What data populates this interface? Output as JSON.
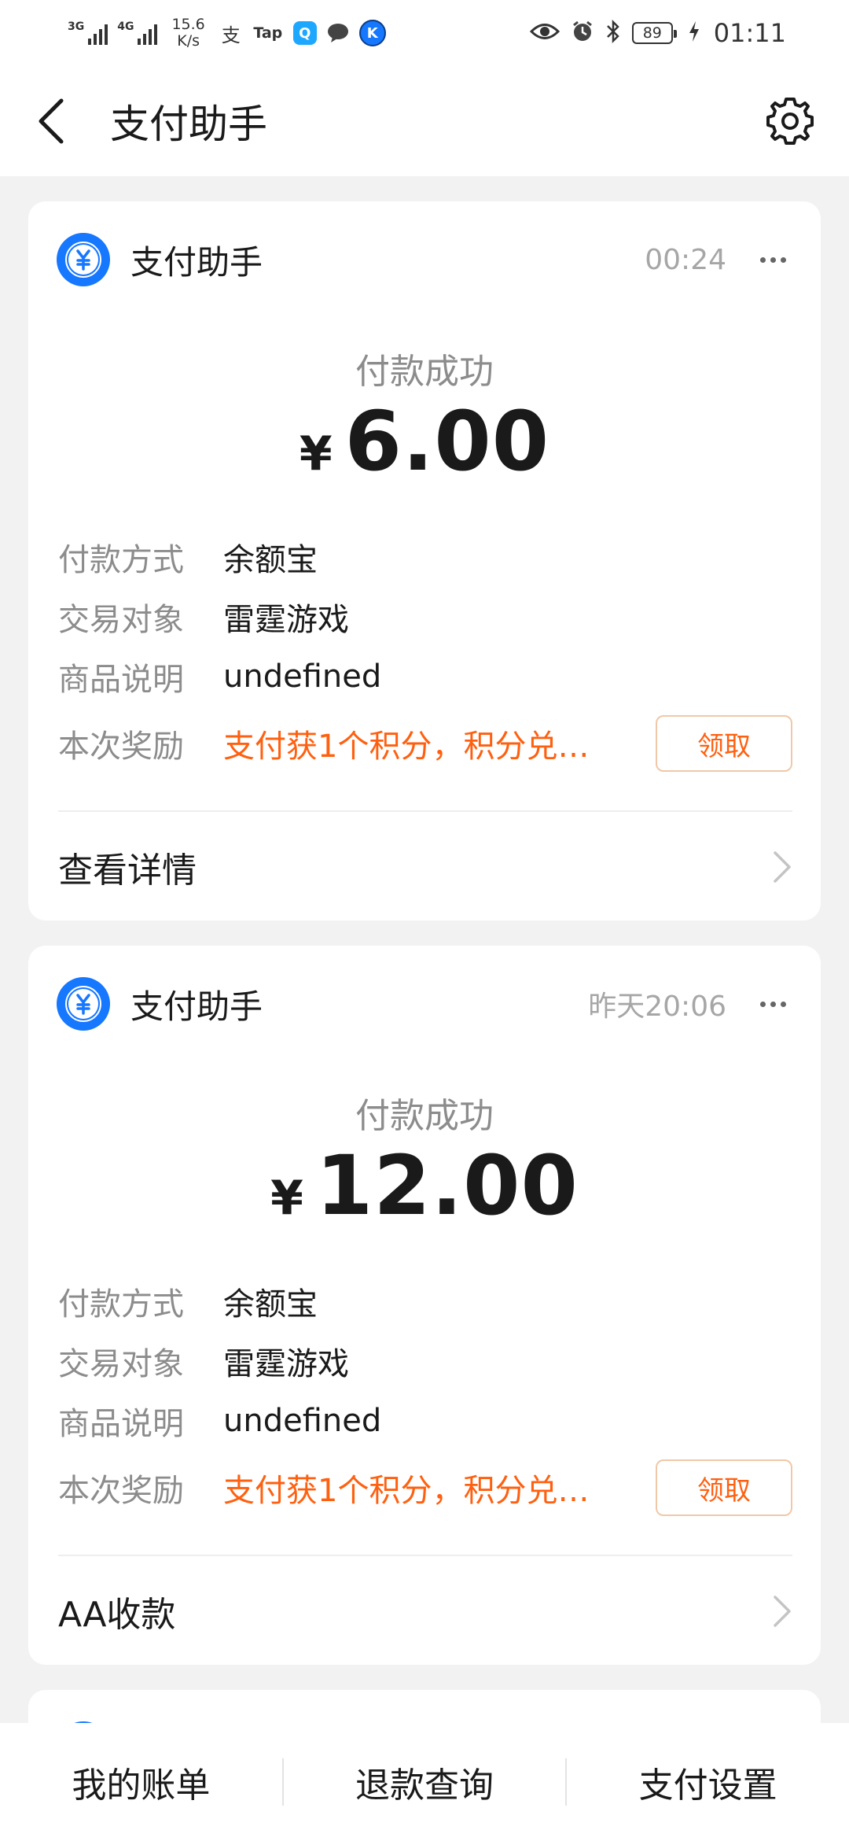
{
  "status_bar": {
    "net1": "3G",
    "net2": "4G",
    "speed_value": "15.6",
    "speed_unit": "K/s",
    "battery": "89",
    "time": "01:11",
    "app_icons": [
      "alipay-icon",
      "tap-icon",
      "q-icon",
      "chat-icon",
      "k-icon"
    ],
    "tap_label": "Tap"
  },
  "header": {
    "title": "支付助手"
  },
  "cards": [
    {
      "sender": "支付助手",
      "time": "00:24",
      "status": "付款成功",
      "currency": "¥",
      "amount": "6.00",
      "rows": {
        "method_label": "付款方式",
        "method_value": "余额宝",
        "party_label": "交易对象",
        "party_value": "雷霆游戏",
        "item_label": "商品说明",
        "item_value": "undefined",
        "reward_label": "本次奖励",
        "reward_value": "支付获1个积分，积分兑…"
      },
      "claim_label": "领取",
      "link_label": "查看详情"
    },
    {
      "sender": "支付助手",
      "time": "昨天20:06",
      "status": "付款成功",
      "currency": "¥",
      "amount": "12.00",
      "rows": {
        "method_label": "付款方式",
        "method_value": "余额宝",
        "party_label": "交易对象",
        "party_value": "雷霆游戏",
        "item_label": "商品说明",
        "item_value": "undefined",
        "reward_label": "本次奖励",
        "reward_value": "支付获1个积分，积分兑…"
      },
      "claim_label": "领取",
      "link_label": "AA收款"
    }
  ],
  "bottom_tabs": [
    "我的账单",
    "退款查询",
    "支付设置"
  ],
  "colors": {
    "accent_blue": "#1677ff",
    "reward_orange": "#ff6010",
    "muted_gray": "#8c8c8c"
  }
}
